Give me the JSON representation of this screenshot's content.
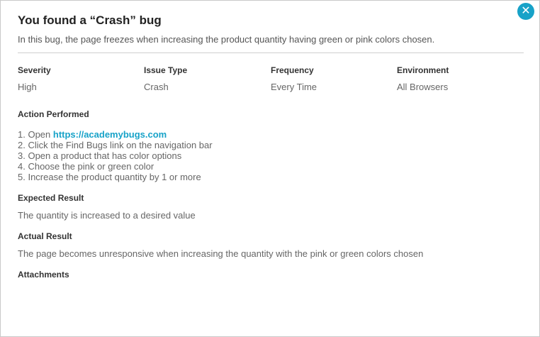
{
  "modal": {
    "title": "You found a “Crash” bug",
    "description": "In this bug, the page freezes when increasing the product quantity having green or pink colors chosen.",
    "close_icon": "close-icon",
    "accent_color": "#17a2c8"
  },
  "meta": {
    "severity_label": "Severity",
    "severity_value": "High",
    "issue_type_label": "Issue Type",
    "issue_type_value": "Crash",
    "frequency_label": "Frequency",
    "frequency_value": "Every Time",
    "environment_label": "Environment",
    "environment_value": "All Browsers"
  },
  "action": {
    "heading": "Action Performed",
    "step1_prefix": "1. Open ",
    "step1_link": "https://academybugs.com",
    "step2": "2. Click the Find Bugs link on the navigation bar",
    "step3": "3. Open a product that has color options",
    "step4": "4. Choose the pink or green color",
    "step5": "5. Increase the product quantity by 1 or more"
  },
  "expected": {
    "heading": "Expected Result",
    "text": "The quantity is increased to a desired value"
  },
  "actual": {
    "heading": "Actual Result",
    "text": "The page becomes unresponsive when increasing the quantity with the pink or green colors chosen"
  },
  "attachments": {
    "heading": "Attachments"
  }
}
